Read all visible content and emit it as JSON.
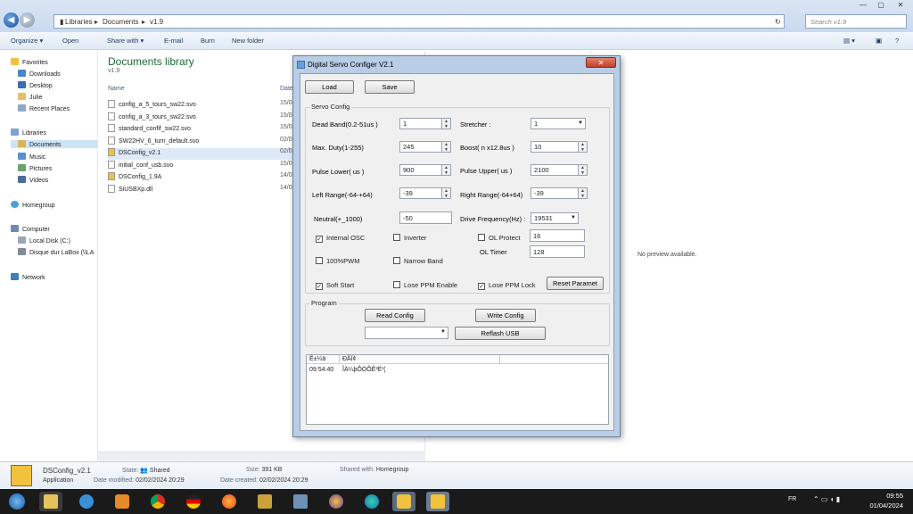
{
  "explorer": {
    "breadcrumbs": [
      "Libraries",
      "Documents",
      "v1.9"
    ],
    "search_placeholder": "Search v1.9",
    "toolbar": [
      "Organize ▾",
      "Open",
      "Share with ▾",
      "E-mail",
      "Burn",
      "New folder"
    ],
    "nav": {
      "favorites_label": "Favorites",
      "favorites": [
        "Downloads",
        "Desktop",
        "Julie",
        "Recent Places"
      ],
      "libraries_label": "Libraries",
      "libraries": [
        "Documents",
        "Music",
        "Pictures",
        "Videos"
      ],
      "homegroup": "Homegroup",
      "computer_label": "Computer",
      "drives": [
        "Local Disk (C:)",
        "Disque dur LaBox (\\\\LA"
      ],
      "network": "Network"
    },
    "library_title": "Documents library",
    "library_sub": "v1.9",
    "col_name": "Name",
    "col_date": "Date",
    "files": [
      {
        "name": "config_a_5_tours_sw22.svo",
        "date": "15/0"
      },
      {
        "name": "config_a_3_tours_sw22.svo",
        "date": "15/0"
      },
      {
        "name": "standard_confif_sw22.svo",
        "date": "15/0"
      },
      {
        "name": "SW22HV_6_turn_default.svo",
        "date": "02/0"
      },
      {
        "name": "DSConfig_v2.1",
        "date": "02/0"
      },
      {
        "name": "initial_conf_usb.svo",
        "date": "15/0"
      },
      {
        "name": "DSConfig_1.9A",
        "date": "14/0"
      },
      {
        "name": "SiUSBXp.dll",
        "date": "14/0"
      }
    ],
    "preview_text": "No preview available."
  },
  "details": {
    "name": "DSConfig_v2.1",
    "type": "Application",
    "state_label": "State:",
    "state": "Shared",
    "modified_label": "Date modified:",
    "modified": "02/02/2024 20:29",
    "size_label": "Size:",
    "size": "391 KB",
    "created_label": "Date created:",
    "created": "02/02/2024 20:29",
    "shared_label": "Shared with:",
    "shared": "Homegroup"
  },
  "taskbar": {
    "lang": "FR",
    "time": "09:55",
    "date": "01/04/2024"
  },
  "dialog": {
    "title": "Digital Servo Configer V2.1",
    "load": "Load",
    "save": "Save",
    "servo_group": "Servo Config",
    "dead_band_label": "Dead Band(0.2-51us )",
    "dead_band": "1",
    "stretcher_label": "Stretcher :",
    "stretcher": "1",
    "max_duty_label": "Max. Duty(1-255)",
    "max_duty": "245",
    "boost_label": "Boost( n x12.8us )",
    "boost": "10",
    "pulse_lower_label": "Pulse Lower( us )",
    "pulse_lower": "900",
    "pulse_upper_label": "Pulse Upper( us )",
    "pulse_upper": "2100",
    "left_range_label": "Left Range(-64-+64)",
    "left_range": "-39",
    "right_range_label": "Right Range(-64+64)",
    "right_range": "-39",
    "neutral_label": "Neutral(+_1000)",
    "neutral": "-50",
    "drive_freq_label": "Drive Frequency(Hz) :",
    "drive_freq": "19531",
    "internal_osc": "Internal OSC",
    "inverter": "Inverter",
    "ol_protect": "OL Protect",
    "ol_protect_value": "16",
    "ol_timer": "OL Timer",
    "ol_timer_value": "128",
    "pwm100": "100%PWM",
    "narrow_band": "Narrow Band",
    "soft_start": "Soft Start",
    "lose_ppm_enable": "Lose PPM Enable",
    "lose_ppm_lock": "Lose PPM Lock",
    "reset_param": "Reset Paramet",
    "program_group": "Program",
    "read_config": "Read Config",
    "write_config": "Write Config",
    "reflash_usb": "Reflash USB",
    "log_col1": "Ê±¼ä",
    "log_col2": "ÐÅÏ¢",
    "log_time": "09:54:40",
    "log_msg": "ÎÄ¼þÕÒÕÊ³É¹¦"
  }
}
